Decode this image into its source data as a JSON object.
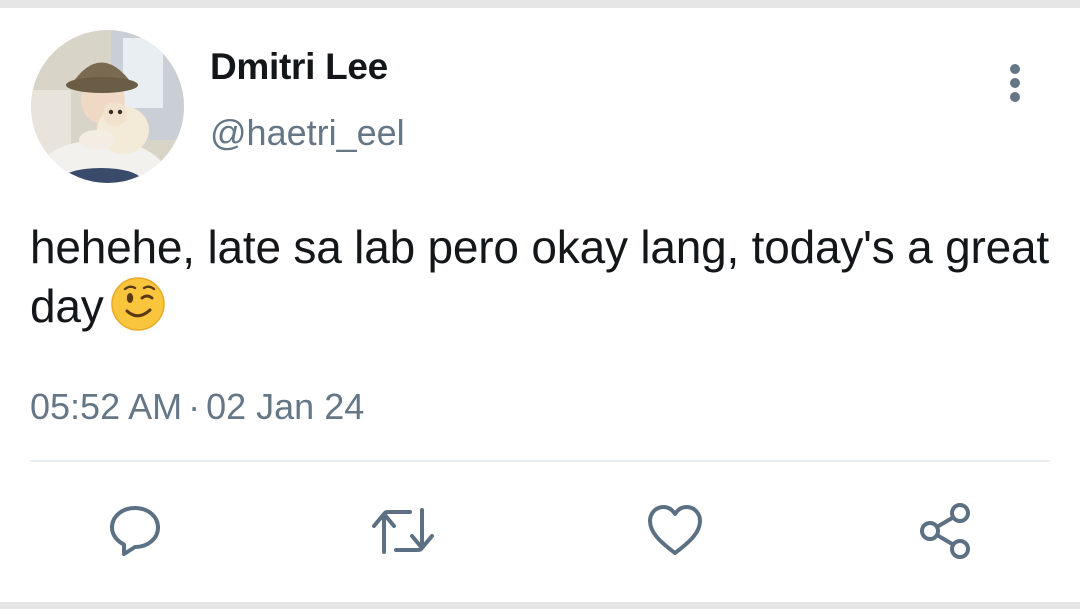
{
  "author": {
    "display_name": "Dmitri Lee",
    "handle": "@haetri_eel"
  },
  "tweet": {
    "text": "hehehe, late sa lab pero okay lang, today's a great day",
    "emoji": "winking-face"
  },
  "meta": {
    "time": "05:52 AM",
    "separator": "·",
    "date": "02 Jan 24"
  },
  "actions": [
    "reply-icon",
    "retweet-icon",
    "like-icon",
    "share-icon"
  ],
  "colors": {
    "text": "#14171a",
    "secondary": "#657786",
    "icon": "#5b7083",
    "divider": "#e6ecf0",
    "background": "#ffffff"
  }
}
